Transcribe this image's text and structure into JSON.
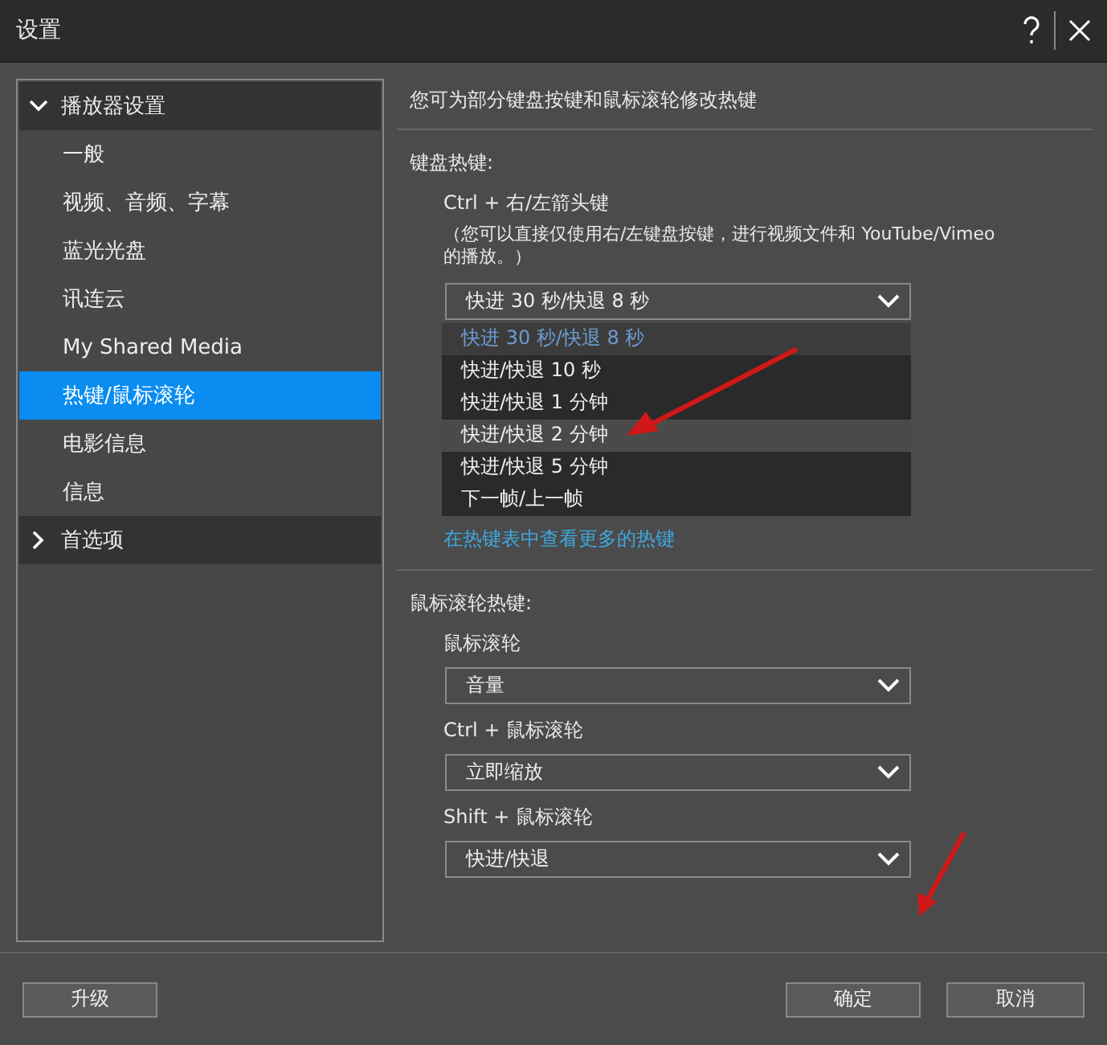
{
  "window": {
    "title": "设置"
  },
  "sidebar": {
    "groups": [
      {
        "label": "播放器设置",
        "expanded": true,
        "items": [
          {
            "label": "一般",
            "selected": false
          },
          {
            "label": "视频、音频、字幕",
            "selected": false
          },
          {
            "label": "蓝光光盘",
            "selected": false
          },
          {
            "label": "讯连云",
            "selected": false
          },
          {
            "label": "My Shared Media",
            "selected": false
          },
          {
            "label": "热键/鼠标滚轮",
            "selected": true
          },
          {
            "label": "电影信息",
            "selected": false
          },
          {
            "label": "信息",
            "selected": false
          }
        ]
      },
      {
        "label": "首选项",
        "expanded": false
      }
    ]
  },
  "content": {
    "intro": "您可为部分键盘按键和鼠标滚轮修改热键",
    "keyboard": {
      "heading": "键盘热键:",
      "label": "Ctrl + 右/左箭头键",
      "note": "（您可以直接仅使用右/左键盘按键，进行视频文件和 YouTube/Vimeo 的播放。）",
      "dropdown": {
        "value": "快进 30 秒/快退 8 秒",
        "options": [
          {
            "label": "快进 30 秒/快退 8 秒",
            "selected": true,
            "highlighted": false
          },
          {
            "label": "快进/快退 10 秒",
            "selected": false,
            "highlighted": false
          },
          {
            "label": "快进/快退 1 分钟",
            "selected": false,
            "highlighted": false
          },
          {
            "label": "快进/快退 2 分钟",
            "selected": false,
            "highlighted": true
          },
          {
            "label": "快进/快退 5 分钟",
            "selected": false,
            "highlighted": false
          },
          {
            "label": "下一帧/上一帧",
            "selected": false,
            "highlighted": false
          }
        ]
      },
      "link": "在热键表中查看更多的热键"
    },
    "mouse": {
      "heading": "鼠标滚轮热键:",
      "rows": [
        {
          "label": "鼠标滚轮",
          "value": "音量"
        },
        {
          "label": "Ctrl + 鼠标滚轮",
          "value": "立即缩放"
        },
        {
          "label": "Shift + 鼠标滚轮",
          "value": "快进/快退"
        }
      ]
    }
  },
  "footer": {
    "upgrade": "升级",
    "ok": "确定",
    "cancel": "取消"
  }
}
